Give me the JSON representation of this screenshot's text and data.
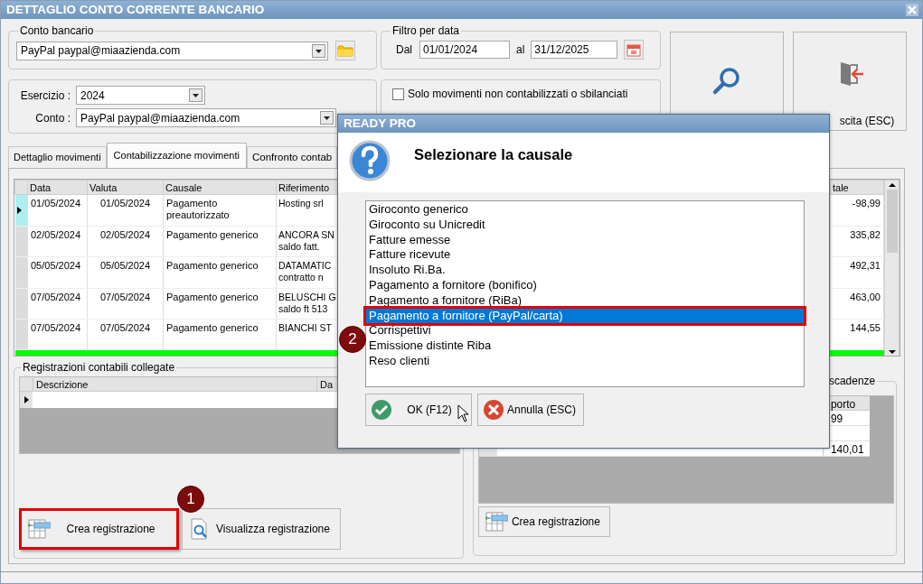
{
  "window": {
    "title": "DETTAGLIO CONTO CORRENTE BANCARIO"
  },
  "conto_bancario": {
    "legend": "Conto bancario",
    "value": "PayPal paypal@miaazienda.com"
  },
  "filtro": {
    "legend": "Filtro per data",
    "from_label": "Dal",
    "from": "01/01/2024",
    "to_label": "al",
    "to": "31/12/2025"
  },
  "esercizio": {
    "label": "Esercizio :",
    "value": "2024"
  },
  "conto": {
    "label": "Conto :",
    "value": "PayPal paypal@miaazienda.com"
  },
  "solo_movimenti": {
    "label": "Solo movimenti non contabilizzati o sbilanciati",
    "checked": false
  },
  "exit_button": {
    "label": "scita (ESC)"
  },
  "tabs": [
    {
      "label": "Dettaglio movimenti",
      "selected": false
    },
    {
      "label": "Contabilizzazione movimenti",
      "selected": true
    },
    {
      "label": "Confronto contab",
      "selected": false
    }
  ],
  "movements_grid": {
    "columns": [
      "Data",
      "Valuta",
      "Causale",
      "Riferimento"
    ],
    "column_5": "tale",
    "rows": [
      {
        "selected": true,
        "color": "#ffffff",
        "cells": [
          "01/05/2024",
          "01/05/2024",
          "Pagamento preautorizzato",
          "Hosting srl",
          "-98,99"
        ]
      },
      {
        "selected": false,
        "color": "#ffffff",
        "cells": [
          "02/05/2024",
          "02/05/2024",
          "Pagamento generico",
          "ANCORA SN\nsaldo fatt.",
          "335,82"
        ]
      },
      {
        "selected": false,
        "color": "#ffffff",
        "cells": [
          "05/05/2024",
          "05/05/2024",
          "Pagamento generico",
          "DATAMATIC\ncontratto n",
          "492,31"
        ]
      },
      {
        "selected": false,
        "color": "#ffffff",
        "cells": [
          "07/05/2024",
          "07/05/2024",
          "Pagamento generico",
          "BELUSCHI G\nsaldo ft 513",
          "463,00"
        ]
      },
      {
        "selected": false,
        "color": "#ffffff",
        "cells": [
          "07/05/2024",
          "07/05/2024",
          "Pagamento generico",
          "BIANCHI ST",
          "144,55"
        ]
      },
      {
        "color": "#00ff00"
      }
    ]
  },
  "registrazioni": {
    "legend": "Registrazioni contabili collegate",
    "columns": [
      "Descrizione",
      "Da"
    ],
    "buttons": [
      {
        "kind": "create",
        "label": "Crea registrazione",
        "highlighted": true,
        "badge": "1"
      },
      {
        "kind": "view",
        "label": "Visualizza registrazione",
        "highlighted": false
      }
    ]
  },
  "scadenze": {
    "legend": "scadenze",
    "column": "porto",
    "rows": [
      {
        "kind": "amount",
        "amount": "99"
      },
      {
        "kind": "obscured"
      },
      {
        "kind": "amount",
        "amount": "140,01"
      }
    ],
    "button": "Crea registrazione"
  },
  "dialog": {
    "title": "READY PRO",
    "heading": "Selezionare la causale",
    "badge": "2",
    "items": [
      {
        "label": "Giroconto generico",
        "selected": false,
        "highlighted": false
      },
      {
        "label": "Giroconto su Unicredit",
        "selected": false,
        "highlighted": false
      },
      {
        "label": "Fatture emesse",
        "selected": false,
        "highlighted": false
      },
      {
        "label": "Fatture ricevute",
        "selected": false,
        "highlighted": false
      },
      {
        "label": "Insoluto Ri.Ba.",
        "selected": false,
        "highlighted": false
      },
      {
        "label": "Pagamento a fornitore (bonifico)",
        "selected": false,
        "highlighted": false
      },
      {
        "label": "Pagamento a fornitore (RiBa)",
        "selected": false,
        "highlighted": false
      },
      {
        "label": "Pagamento a fornitore (PayPal/carta)",
        "selected": true,
        "highlighted": true
      },
      {
        "label": "Corrispettivi",
        "selected": false,
        "highlighted": false
      },
      {
        "label": "Emissione distinte Riba",
        "selected": false,
        "highlighted": false
      },
      {
        "label": "Reso clienti",
        "selected": false,
        "highlighted": false
      }
    ],
    "buttons": [
      {
        "kind": "ok",
        "label": "OK (F12)"
      },
      {
        "kind": "cancel",
        "label": "Annulla (ESC)"
      }
    ]
  }
}
